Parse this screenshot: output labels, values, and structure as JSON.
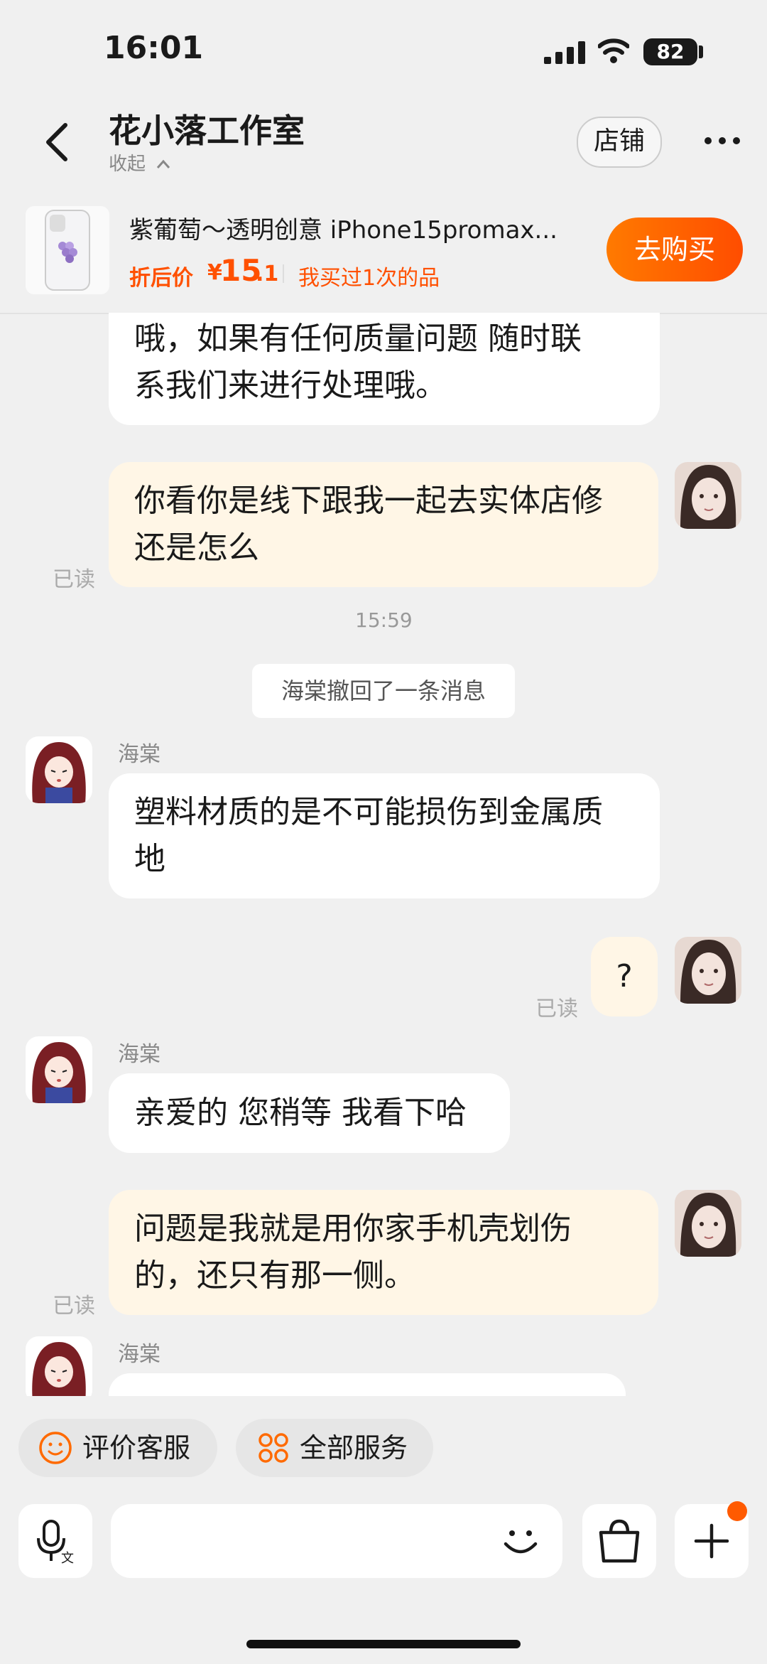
{
  "status_bar": {
    "time": "16:01",
    "battery": "82"
  },
  "header": {
    "title": "花小落工作室",
    "collapse_label": "收起",
    "store_label": "店铺"
  },
  "product": {
    "title": "紫葡萄～透明创意 iPhone15promax...",
    "price_label": "折后价",
    "price_symbol": "¥",
    "price_main": "15",
    "price_sub": ".1",
    "bought_label": "我买过1次的品",
    "buy_label": "去购买"
  },
  "messages": {
    "m1_text_l1": "哦，如果有任何质量问题 随时联",
    "m1_text_l2": "系我们来进行处理哦。",
    "m2_text_l1": "你看你是线下跟我一起去实体店修",
    "m2_text_l2": "还是怎么",
    "read_label": "已读",
    "timestamp": "15:59",
    "recall_notice": "海棠撤回了一条消息",
    "agent_name": "海棠",
    "m3_text_l1": "塑料材质的是不可能损伤到金属质",
    "m3_text_l2": "地",
    "m4_text": "?",
    "m5_text": "亲爱的 您稍等 我看下哈",
    "m6_text_l1": "问题是我就是用你家手机壳划伤",
    "m6_text_l2": "的，还只有那一侧。"
  },
  "bottom": {
    "rate_label": "评价客服",
    "services_label": "全部服务"
  },
  "colors": {
    "accent": "#ff5000",
    "outgoing_bubble": "#fff6e6",
    "incoming_bubble": "#ffffff"
  }
}
